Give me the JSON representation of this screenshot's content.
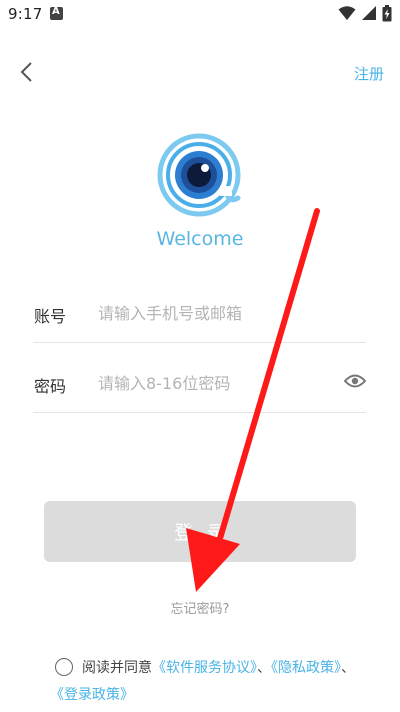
{
  "status_bar": {
    "time": "9:17",
    "icons": [
      "notification-a-icon",
      "wifi-icon",
      "signal-icon",
      "battery-charging-icon"
    ]
  },
  "nav": {
    "back_icon": "chevron-left-icon",
    "register_label": "注册"
  },
  "brand": {
    "logo_icon": "eye-at-logo",
    "welcome": "Welcome"
  },
  "form": {
    "account_label": "账号",
    "account_placeholder": "请输入手机号或邮箱",
    "password_label": "密码",
    "password_placeholder": "请输入8-16位密码",
    "password_toggle_icon": "eye-icon"
  },
  "actions": {
    "login_label": "登录",
    "forgot_label": "忘记密码?"
  },
  "agreement": {
    "prefix": "阅读并同意",
    "software_agreement": "《软件服务协议》",
    "sep1": "、",
    "privacy_policy": "《隐私政策》",
    "sep2": "、",
    "login_policy": "《登录政策》"
  },
  "colors": {
    "accent": "#4ab3e6",
    "button_disabled": "#dcdcdc",
    "annotation_arrow": "#ff1a1a"
  }
}
